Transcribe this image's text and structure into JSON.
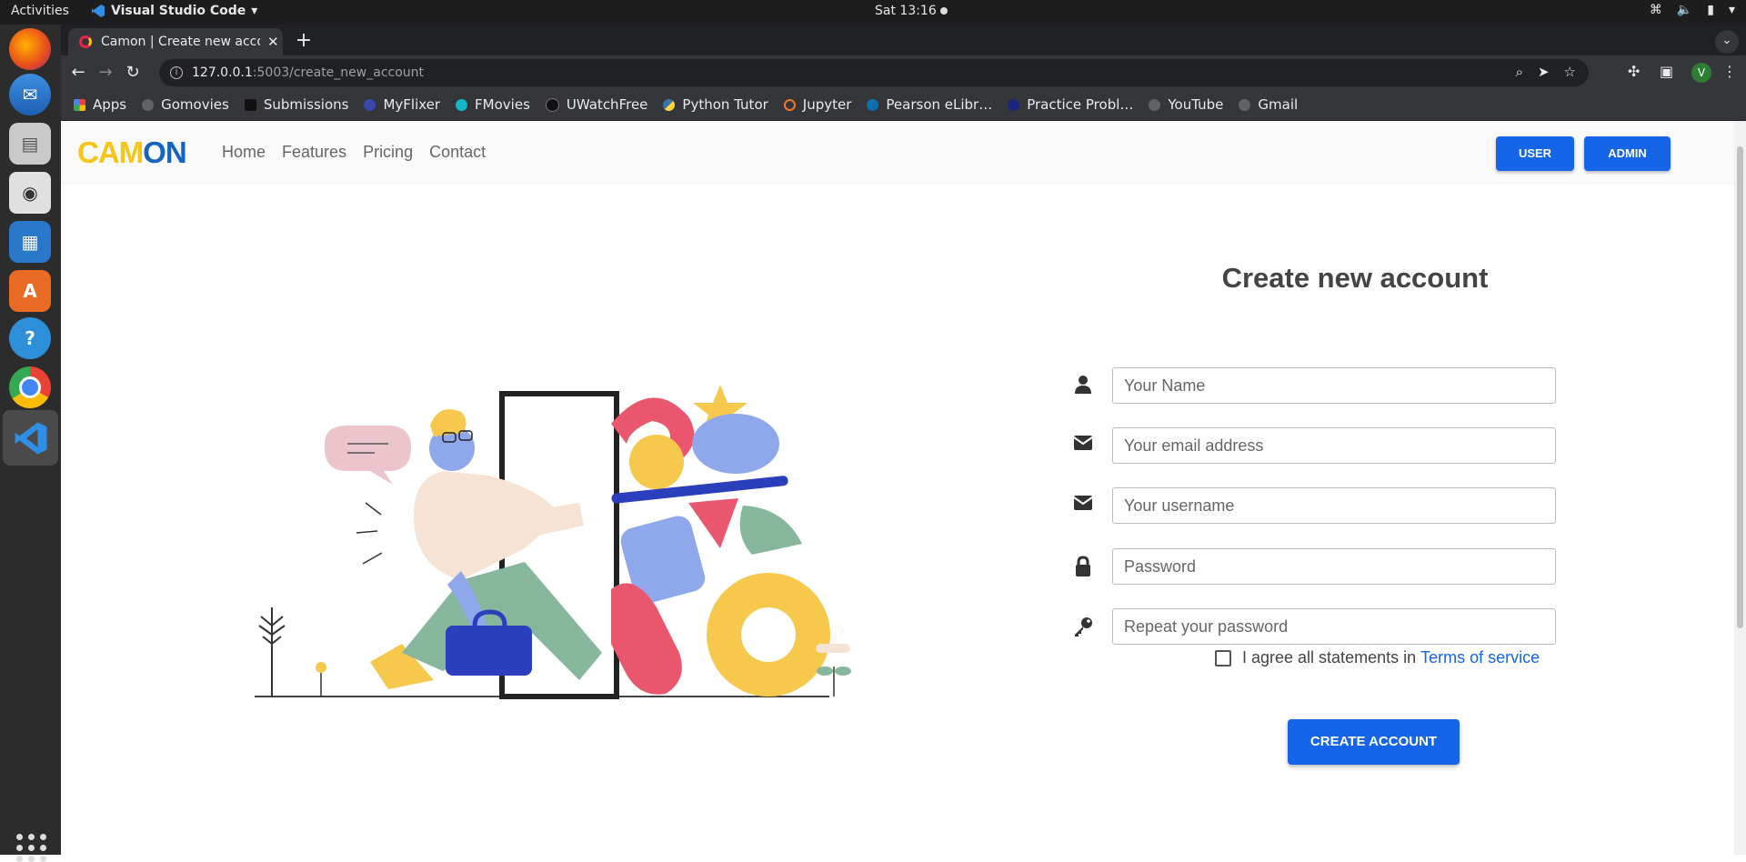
{
  "system": {
    "activities": "Activities",
    "app_name": "Visual Studio Code",
    "clock": "Sat 13:16"
  },
  "dock": {
    "apps": [
      "firefox-icon",
      "thunderbird-icon",
      "files-icon",
      "rhythmbox-icon",
      "writer-icon",
      "software-icon",
      "help-icon",
      "chrome-icon",
      "vscode-icon"
    ],
    "active": "vscode-icon"
  },
  "browser": {
    "tab_title": "Camon | Create new account",
    "url_host": "127.0.0.1",
    "url_path": ":5003/create_new_account",
    "profile_initial": "V",
    "bookmarks": [
      "Apps",
      "Gomovies",
      "Submissions",
      "MyFlixer",
      "FMovies",
      "UWatchFree",
      "Python Tutor",
      "Jupyter",
      "Pearson eLibr…",
      "Practice Probl…",
      "YouTube",
      "Gmail"
    ]
  },
  "site": {
    "logo_part1": "CAM",
    "logo_part2": "ON",
    "nav": [
      "Home",
      "Features",
      "Pricing",
      "Contact"
    ],
    "user_button": "USER",
    "admin_button": "ADMIN"
  },
  "form": {
    "title": "Create new account",
    "name_placeholder": "Your Name",
    "email_placeholder": "Your email address",
    "username_placeholder": "Your username",
    "password_placeholder": "Password",
    "repeat_password_placeholder": "Repeat your password",
    "agree_text": "I agree all statements in",
    "terms_link": "Terms of service",
    "submit_label": "CREATE ACCOUNT"
  },
  "colors": {
    "accent": "#1565e6",
    "logo_yellow": "#f5c518",
    "logo_blue": "#1565c0"
  }
}
